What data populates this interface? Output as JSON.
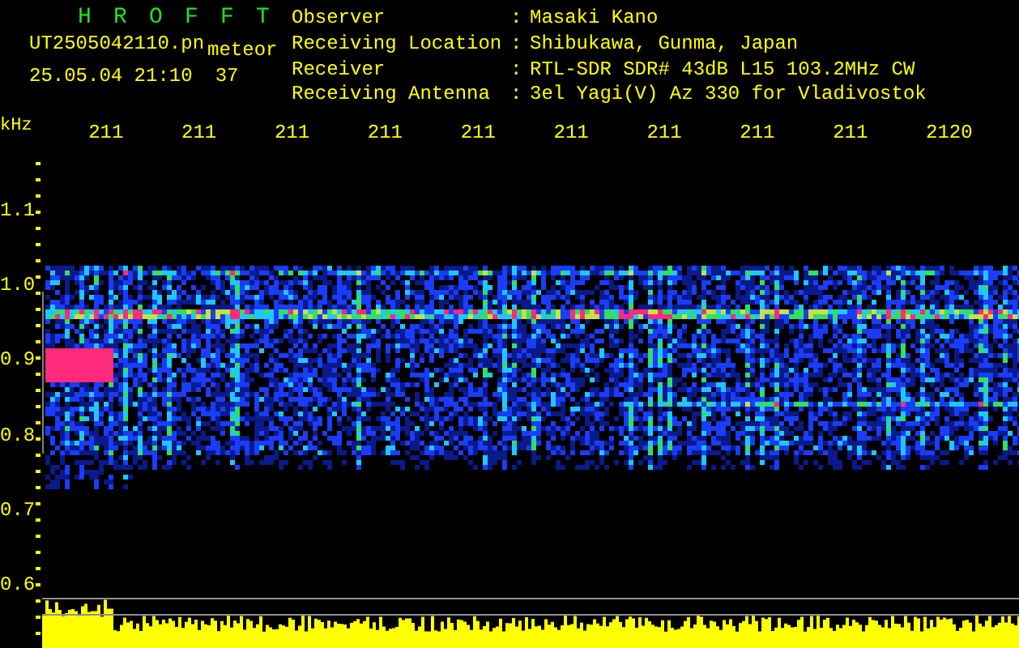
{
  "title": "H R O F F T",
  "file": {
    "name": "UT2505042110.pn",
    "type": "meteor",
    "date": "25.05.04 21:10",
    "count": "37"
  },
  "info": [
    {
      "label": "Observer",
      "separator": ":",
      "value": "Masaki Kano"
    },
    {
      "label": "Receiving Location",
      "separator": ":",
      "value": "Shibukawa, Gunma, Japan"
    },
    {
      "label": "Receiver",
      "separator": ":",
      "value": "RTL-SDR SDR# 43dB L15 103.2MHz CW"
    },
    {
      "label": "Receiving Antenna",
      "separator": ":",
      "value": "3el Yagi(V) Az 330 for Vladivostok"
    }
  ],
  "x_axis": {
    "unit": "kHz",
    "ticks": [
      "211",
      "211",
      "211",
      "211",
      "211",
      "211",
      "211",
      "211",
      "211",
      "2120"
    ]
  },
  "y_axis": {
    "ticks": [
      "1.1",
      "1.0",
      "0.9",
      "0.8",
      "0.7",
      "0.6"
    ]
  }
}
